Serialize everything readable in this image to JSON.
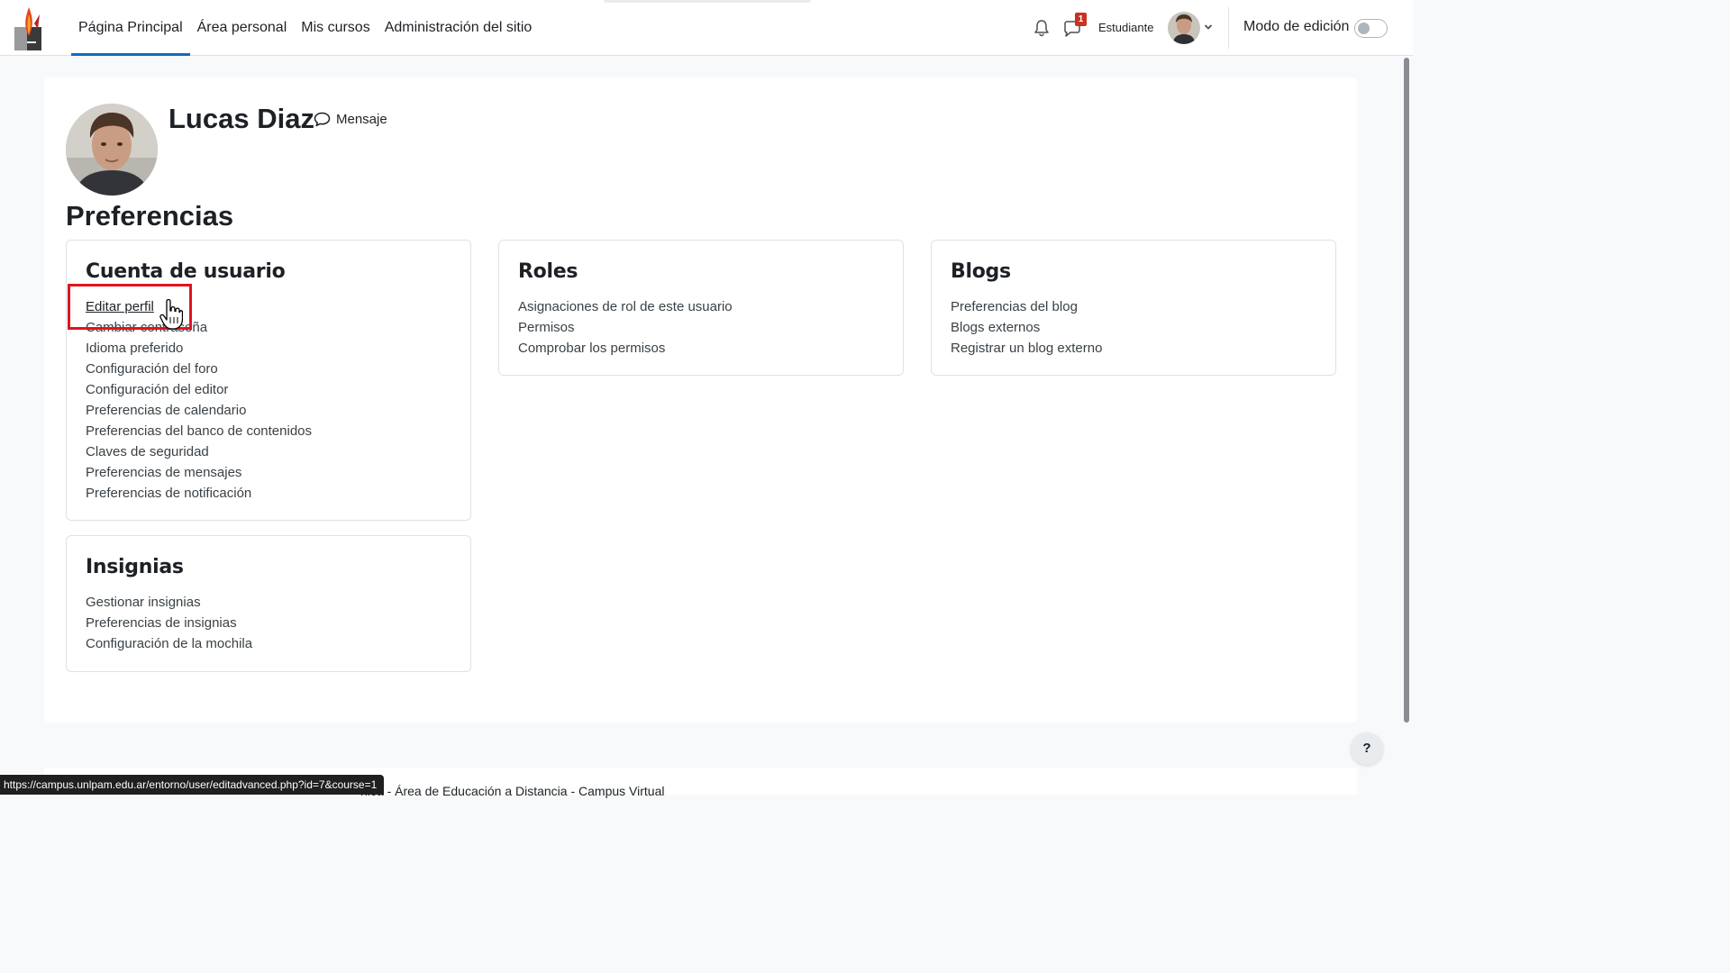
{
  "navbar": {
    "items": [
      {
        "label": "Página Principal",
        "active": true
      },
      {
        "label": "Área personal",
        "active": false
      },
      {
        "label": "Mis cursos",
        "active": false
      },
      {
        "label": "Administración del sitio",
        "active": false
      }
    ],
    "messages_badge": "1",
    "role_label": "Estudiante",
    "edit_mode_label": "Modo de edición",
    "edit_mode_on": false
  },
  "profile": {
    "name": "Lucas Diaz",
    "message_label": "Mensaje"
  },
  "page_heading": "Preferencias",
  "cards": {
    "cuenta": {
      "title": "Cuenta de usuario",
      "links": [
        "Editar perfil",
        "Cambiar contraseña",
        "Idioma preferido",
        "Configuración del foro",
        "Configuración del editor",
        "Preferencias de calendario",
        "Preferencias del banco de contenidos",
        "Claves de seguridad",
        "Preferencias de mensajes",
        "Preferencias de notificación"
      ]
    },
    "roles": {
      "title": "Roles",
      "links": [
        "Asignaciones de rol de este usuario",
        "Permisos",
        "Comprobar los permisos"
      ]
    },
    "blogs": {
      "title": "Blogs",
      "links": [
        "Preferencias del blog",
        "Blogs externos",
        "Registrar un blog externo"
      ]
    },
    "insignias": {
      "title": "Insignias",
      "links": [
        "Gestionar insignias",
        "Preferencias de insignias",
        "Configuración de la mochila"
      ]
    }
  },
  "footer_text": "nica - Área de Educación a Distancia - Campus Virtual",
  "status_url": "https://campus.unlpam.edu.ar/entorno/user/editadvanced.php?id=7&course=1",
  "help_label": "?",
  "colors": {
    "accent": "#0f6cbf",
    "highlight": "#e0141e",
    "badge": "#ca3120"
  }
}
